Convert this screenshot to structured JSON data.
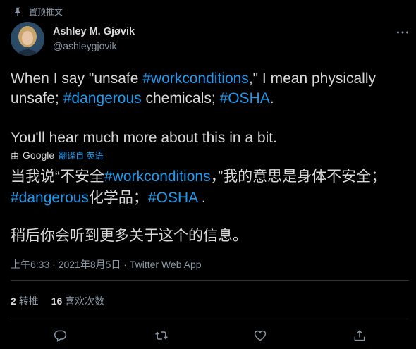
{
  "pinned_label": "置顶推文",
  "author": {
    "name": "Ashley M. Gjøvik",
    "handle": "@ashleygjovik"
  },
  "tweet": {
    "line1_a": "When I say \"unsafe ",
    "hashtag_work": "#workconditions",
    "line1_b": ",\" I mean physically unsafe; ",
    "hashtag_dangerous": "#dangerous",
    "line1_c": " chemicals; ",
    "hashtag_osha": "#OSHA",
    "line1_d": ".",
    "line2": "You'll hear much more about this in a bit."
  },
  "translation_bar": {
    "by": "由",
    "google": "Google",
    "link": "翻译自 英语"
  },
  "translation": {
    "p1_a": "当我说“不安全",
    "hashtag_work": "#workconditions",
    "p1_b": "，”我的意思是身体不安全；",
    "hashtag_dangerous": "#dangerous",
    "p1_c": "化学品；",
    "hashtag_osha": "#OSHA",
    "p1_d": " .",
    "p2": "稍后你会听到更多关于这个的信息。"
  },
  "meta": "上午6:33 · 2021年8月5日 · Twitter Web App",
  "stats": {
    "retweets_count": "2",
    "retweets_label": "转推",
    "likes_count": "16",
    "likes_label": "喜欢次数"
  },
  "icons": [
    "pin-icon",
    "avatar",
    "more-icon",
    "reply-icon",
    "retweet-icon",
    "like-icon",
    "share-icon"
  ],
  "colors": {
    "background": "#000000",
    "text": "#d9d9d9",
    "secondary": "#8b98a5",
    "accent": "#1d9bf0",
    "divider": "#2f3336"
  }
}
